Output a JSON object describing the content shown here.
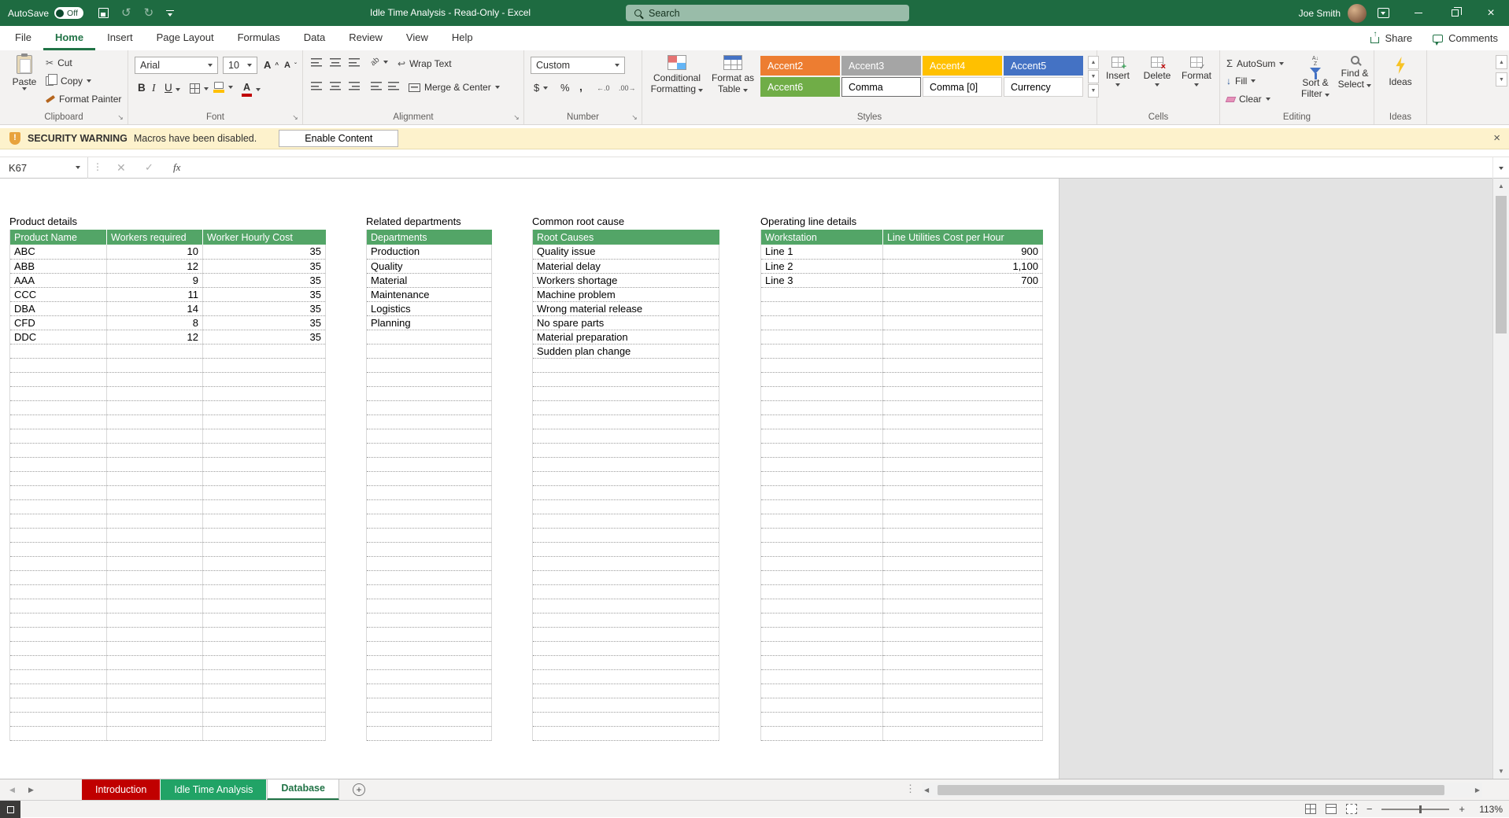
{
  "titlebar": {
    "autosave_label": "AutoSave",
    "autosave_state": "Off",
    "title": "Idle Time Analysis  -  Read-Only  -  Excel",
    "search_placeholder": "Search",
    "user_name": "Joe Smith"
  },
  "menubar": {
    "tabs": [
      "File",
      "Home",
      "Insert",
      "Page Layout",
      "Formulas",
      "Data",
      "Review",
      "View",
      "Help"
    ],
    "active_tab": "Home",
    "share": "Share",
    "comments": "Comments"
  },
  "ribbon": {
    "clipboard": {
      "group": "Clipboard",
      "paste": "Paste",
      "cut": "Cut",
      "copy": "Copy",
      "format_painter": "Format Painter"
    },
    "font": {
      "group": "Font",
      "family": "Arial",
      "size": "10",
      "bold": "B",
      "italic": "I",
      "underline": "U"
    },
    "alignment": {
      "group": "Alignment",
      "wrap_text": "Wrap Text",
      "merge_center": "Merge & Center"
    },
    "number": {
      "group": "Number",
      "format": "Custom",
      "currency": "$",
      "percent": "%",
      "comma": ",",
      "inc_dec": "←.0",
      "dec_dec": ".00→"
    },
    "styles": {
      "group": "Styles",
      "conditional_line1": "Conditional",
      "conditional_line2": "Formatting",
      "format_table_line1": "Format as",
      "format_table_line2": "Table",
      "gallery": [
        {
          "label": "Accent2",
          "bg": "#ED7D31",
          "fg": "#FFFFFF"
        },
        {
          "label": "Accent3",
          "bg": "#A5A5A5",
          "fg": "#FFFFFF"
        },
        {
          "label": "Accent4",
          "bg": "#FFC000",
          "fg": "#FFFFFF"
        },
        {
          "label": "Accent5",
          "bg": "#4472C4",
          "fg": "#FFFFFF"
        },
        {
          "label": "Accent6",
          "bg": "#70AD47",
          "fg": "#FFFFFF"
        },
        {
          "label": "Comma",
          "bg": "#FFFFFF",
          "fg": "#000000",
          "selected": true
        },
        {
          "label": "Comma [0]",
          "bg": "#FFFFFF",
          "fg": "#000000"
        },
        {
          "label": "Currency",
          "bg": "#FFFFFF",
          "fg": "#000000"
        }
      ]
    },
    "cells": {
      "group": "Cells",
      "items": [
        "Insert",
        "Delete",
        "Format"
      ]
    },
    "editing": {
      "group": "Editing",
      "autosum": "AutoSum",
      "fill": "Fill",
      "clear": "Clear",
      "sort_line1": "Sort &",
      "sort_line2": "Filter",
      "find_line1": "Find &",
      "find_line2": "Select"
    },
    "ideas": {
      "group": "Ideas",
      "label": "Ideas"
    }
  },
  "security_bar": {
    "title": "SECURITY WARNING",
    "message": "Macros have been disabled.",
    "button": "Enable Content"
  },
  "formula_bar": {
    "name_box": "K67",
    "fx": "fx"
  },
  "sheet": {
    "header_color": "#53A567",
    "tables": [
      {
        "title": "Product details",
        "headers": [
          "Product Name",
          "Workers required",
          "Worker Hourly Cost"
        ],
        "rows": [
          [
            "ABC",
            "10",
            "35"
          ],
          [
            "ABB",
            "12",
            "35"
          ],
          [
            "AAA",
            "9",
            "35"
          ],
          [
            "CCC",
            "11",
            "35"
          ],
          [
            "DBA",
            "14",
            "35"
          ],
          [
            "CFD",
            "8",
            "35"
          ],
          [
            "DDC",
            "12",
            "35"
          ]
        ]
      },
      {
        "title": "Related departments",
        "headers": [
          "Departments"
        ],
        "rows": [
          [
            "Production"
          ],
          [
            "Quality"
          ],
          [
            "Material"
          ],
          [
            "Maintenance"
          ],
          [
            "Logistics"
          ],
          [
            "Planning"
          ]
        ]
      },
      {
        "title": "Common root cause",
        "headers": [
          "Root Causes"
        ],
        "rows": [
          [
            "Quality issue"
          ],
          [
            "Material delay"
          ],
          [
            "Workers shortage"
          ],
          [
            "Machine problem"
          ],
          [
            "Wrong material release"
          ],
          [
            "No spare parts"
          ],
          [
            "Material preparation"
          ],
          [
            "Sudden plan change"
          ]
        ]
      },
      {
        "title": "Operating line details",
        "headers": [
          "Workstation",
          "Line Utilities Cost per Hour"
        ],
        "rows": [
          [
            "Line 1",
            "900"
          ],
          [
            "Line 2",
            "1,100"
          ],
          [
            "Line 3",
            "700"
          ]
        ]
      }
    ]
  },
  "sheet_tabs": {
    "tabs": [
      {
        "label": "Introduction",
        "color": "#C00000",
        "text": "#FFFFFF"
      },
      {
        "label": "Idle Time Analysis",
        "color": "#21A366",
        "text": "#FFFFFF"
      },
      {
        "label": "Database",
        "color": "#FFFFFF",
        "text": "#217346",
        "active": true
      }
    ]
  },
  "status_bar": {
    "zoom": "113%"
  }
}
